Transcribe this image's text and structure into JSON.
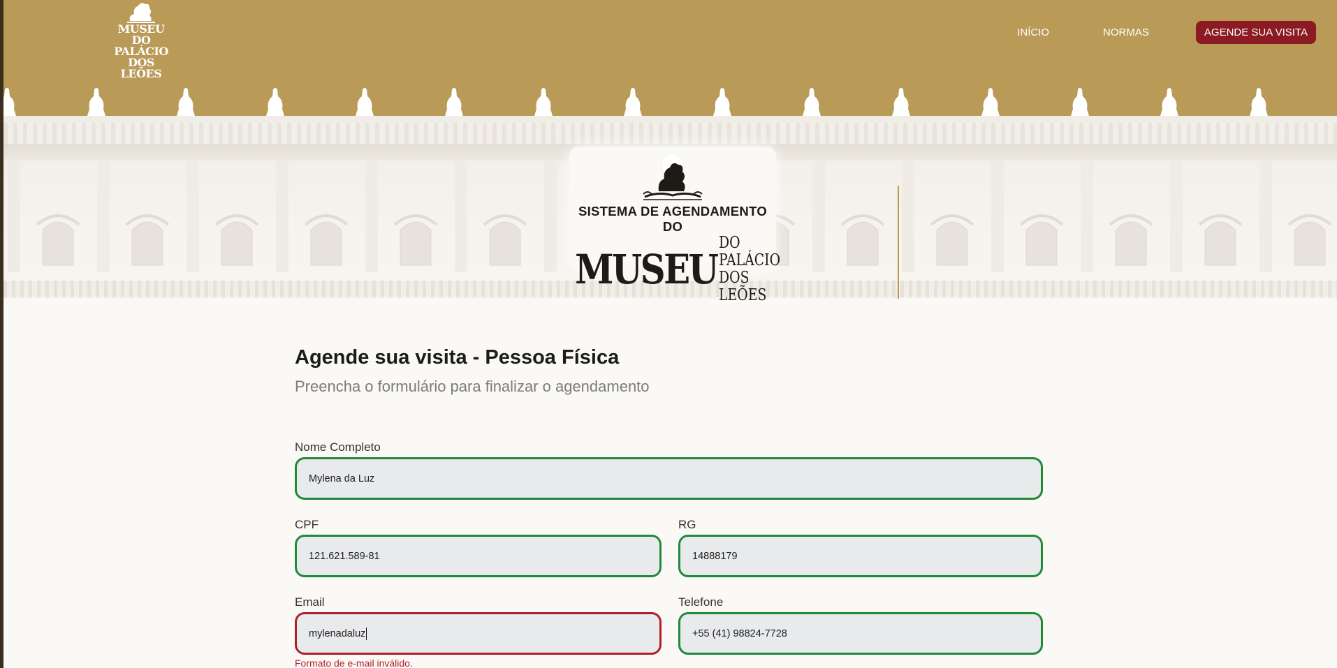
{
  "brand": {
    "logo_line1": "MUSEU DO",
    "logo_line2": "PALÁCIO",
    "logo_line3": "DOS LEÕES"
  },
  "nav": {
    "inicio": "INÍCIO",
    "normas": "NORMAS",
    "cta": "AGENDE SUA VISITA"
  },
  "hero": {
    "system_title": "SISTEMA DE AGENDAMENTO DO",
    "museu": "MUSEU",
    "palacio_line1": "DO PALÁCIO",
    "palacio_line2": "DOS LEÕES"
  },
  "form": {
    "title": "Agende sua visita - Pessoa Física",
    "subtitle": "Preencha o formulário para finalizar o agendamento",
    "fields": {
      "nome": {
        "label": "Nome Completo",
        "value": "Mylena da Luz",
        "state": "valid"
      },
      "cpf": {
        "label": "CPF",
        "value": "121.621.589-81",
        "state": "valid"
      },
      "rg": {
        "label": "RG",
        "value": "14888179",
        "state": "valid"
      },
      "email": {
        "label": "Email",
        "value": "mylenadaluz",
        "state": "invalid",
        "error": "Formato de e-mail inválido."
      },
      "telefone": {
        "label": "Telefone",
        "value": "+55 (41) 98824-7728",
        "state": "valid"
      }
    }
  },
  "colors": {
    "header_gold": "#b99a57",
    "cta_red": "#8b1a22",
    "valid_green": "#1e8a3a",
    "invalid_red": "#b01e2e",
    "page_bg": "#fbf9f5"
  },
  "icons": {
    "header_logo": "museum-lion-emblem-icon",
    "hero_logo": "museum-lion-emblem-icon"
  }
}
